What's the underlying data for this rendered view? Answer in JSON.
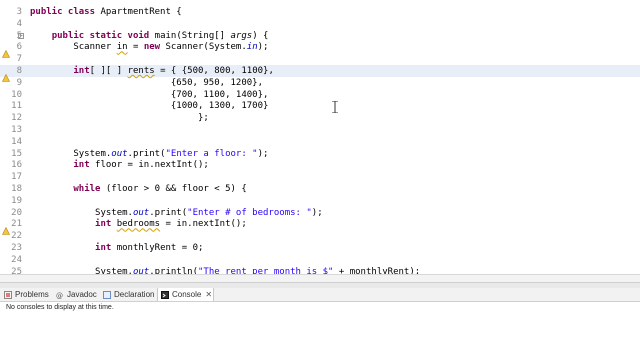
{
  "editor": {
    "lines": [
      {
        "n": "3",
        "html": "<span class=\"kw\">public class</span> ApartmentRent {"
      },
      {
        "n": "4",
        "html": ""
      },
      {
        "n": "5",
        "html": "    <span class=\"kw\">public static void</span> main(String[] <span class=\"par\">args</span>) {"
      },
      {
        "n": "6",
        "html": "        Scanner <span class=\"warn\">in</span> = <span class=\"kw\">new</span> Scanner(System.<span class=\"fld\">in</span>);"
      },
      {
        "n": "7",
        "html": ""
      },
      {
        "n": "8",
        "html": "        <span class=\"kw\">int</span>[ ][ ] <span class=\"warn\">rents</span> = { {500, 800, 1100},"
      },
      {
        "n": "9",
        "html": "                          {650, 950, 1200},"
      },
      {
        "n": "10",
        "html": "                          {700, 1100, 1400},"
      },
      {
        "n": "11",
        "html": "                          {1000, 1300, 1700}"
      },
      {
        "n": "12",
        "html": "                               };"
      },
      {
        "n": "13",
        "html": ""
      },
      {
        "n": "14",
        "html": ""
      },
      {
        "n": "15",
        "html": "        System.<span class=\"fld\">out</span>.print(<span class=\"str\">\"Enter a floor: \"</span>);"
      },
      {
        "n": "16",
        "html": "        <span class=\"kw\">int</span> floor = in.nextInt();"
      },
      {
        "n": "17",
        "html": ""
      },
      {
        "n": "18",
        "html": "        <span class=\"kw\">while</span> (floor > 0 && floor < 5) {"
      },
      {
        "n": "19",
        "html": ""
      },
      {
        "n": "20",
        "html": "            System.<span class=\"fld\">out</span>.print(<span class=\"str\">\"Enter # of bedrooms: \"</span>);"
      },
      {
        "n": "21",
        "html": "            <span class=\"kw\">int</span> <span class=\"warn\">bedrooms</span> = in.nextInt();"
      },
      {
        "n": "22",
        "html": ""
      },
      {
        "n": "23",
        "html": "            <span class=\"kw\">int</span> monthlyRent = 0;"
      },
      {
        "n": "24",
        "html": ""
      },
      {
        "n": "25",
        "html": "            System.<span class=\"fld\">out</span>.println(<span class=\"str\">\"The rent per month is $\"</span> + monthlyRent);"
      }
    ]
  },
  "bottom_panel": {
    "tabs": [
      {
        "label": "Problems",
        "icon": "problems-icon"
      },
      {
        "label": "Javadoc",
        "icon": "javadoc-icon"
      },
      {
        "label": "Declaration",
        "icon": "declaration-icon"
      },
      {
        "label": "Console",
        "icon": "console-icon",
        "active": true
      }
    ],
    "console_message": "No consoles to display at this time."
  }
}
